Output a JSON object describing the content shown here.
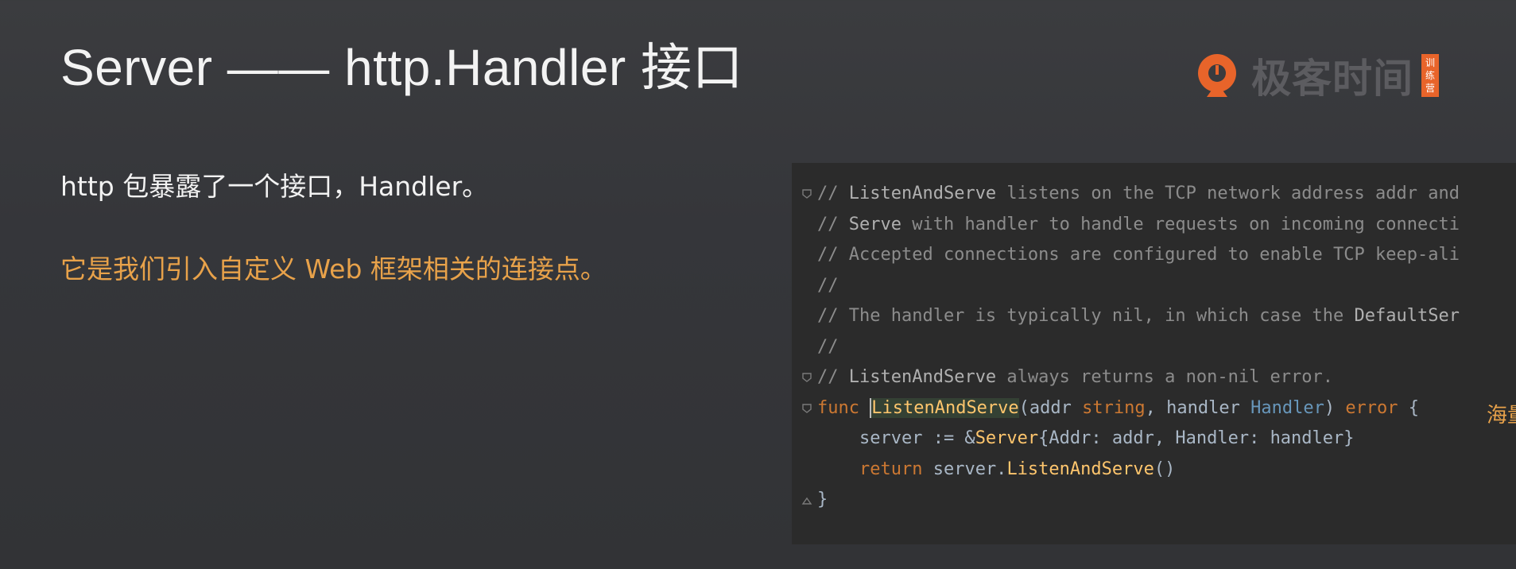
{
  "slide": {
    "title": "Server —— http.Handler 接口",
    "line1": "http 包暴露了一个接口，Handler。",
    "line2": "它是我们引入自定义 Web 框架相关的连接点。"
  },
  "logo": {
    "text": "极客时间",
    "badge": [
      "训",
      "练",
      "营"
    ],
    "icon": "geektime-logo-icon",
    "color": "#e8642a"
  },
  "code": {
    "lines": [
      [
        {
          "t": "// ",
          "c": "comment"
        },
        {
          "t": "ListenAndServe",
          "c": "doc"
        },
        {
          "t": " listens on the TCP network address addr and",
          "c": "comment"
        }
      ],
      [
        {
          "t": "// ",
          "c": "comment"
        },
        {
          "t": "Serve",
          "c": "doc"
        },
        {
          "t": " with handler to handle requests on incoming connecti",
          "c": "comment"
        }
      ],
      [
        {
          "t": "// Accepted connections are configured to enable TCP keep-ali",
          "c": "comment"
        }
      ],
      [
        {
          "t": "//",
          "c": "comment"
        }
      ],
      [
        {
          "t": "// The handler is typically nil, in which case the ",
          "c": "comment"
        },
        {
          "t": "DefaultSer",
          "c": "doc"
        }
      ],
      [
        {
          "t": "//",
          "c": "comment"
        }
      ],
      [
        {
          "t": "// ",
          "c": "comment"
        },
        {
          "t": "ListenAndServe",
          "c": "doc"
        },
        {
          "t": " always returns a non-nil error.",
          "c": "comment"
        }
      ],
      [
        {
          "t": "func ",
          "c": "kw"
        },
        {
          "t": "ListenAndServe",
          "c": "fn",
          "hl": true
        },
        {
          "t": "(addr ",
          "c": "text"
        },
        {
          "t": "string",
          "c": "kw"
        },
        {
          "t": ", handler ",
          "c": "text"
        },
        {
          "t": "Handler",
          "c": "type"
        },
        {
          "t": ") ",
          "c": "text"
        },
        {
          "t": "error",
          "c": "kw"
        },
        {
          "t": " {",
          "c": "text"
        }
      ],
      [
        {
          "t": "    server := &",
          "c": "text"
        },
        {
          "t": "Server",
          "c": "fn"
        },
        {
          "t": "{Addr: addr, Handler: handler}",
          "c": "text"
        }
      ],
      [
        {
          "t": "    ",
          "c": "text"
        },
        {
          "t": "return",
          "c": "kw"
        },
        {
          "t": " server.",
          "c": "text"
        },
        {
          "t": "ListenAndServe",
          "c": "fn"
        },
        {
          "t": "()",
          "c": "text"
        }
      ],
      [
        {
          "t": "}",
          "c": "text"
        }
      ]
    ],
    "side_note": "海量"
  }
}
